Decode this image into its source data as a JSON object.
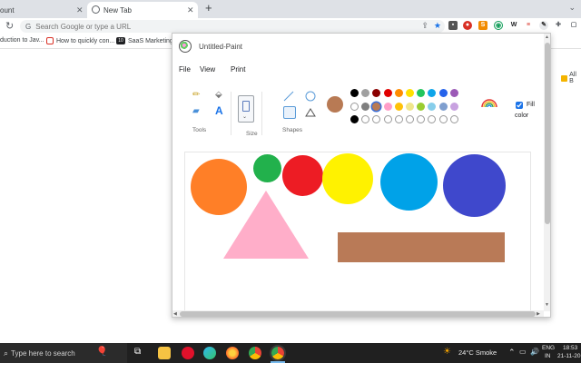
{
  "browser": {
    "tabs": [
      {
        "label": "ount",
        "active": false
      },
      {
        "label": "New Tab",
        "active": true
      }
    ],
    "new_tab_glyph": "+",
    "omnibox": {
      "placeholder": "Search Google or type a URL"
    },
    "bookmarks": [
      {
        "label": "duction to Jav...",
        "icon_color": "#f4b400"
      },
      {
        "label": "How to quickly con...",
        "icon_color": "#d93025"
      },
      {
        "label": "SaaS Marketing P",
        "icon_color": "#202124",
        "icon_text": "10"
      }
    ],
    "bookmarks_right": "All B"
  },
  "paint": {
    "title": "Untitled-Paint",
    "menu": [
      "File",
      "View",
      "Print"
    ],
    "ribbon": {
      "tools_label": "Tools",
      "size_label": "Size",
      "shapes_label": "Shapes",
      "fill_label_1": "Fill",
      "fill_label_2": "color",
      "fill_checked": true,
      "current_color": "#b87a54"
    },
    "palette": {
      "row1": [
        "#000000",
        "#a0a0a0",
        "#8b0000",
        "#e00000",
        "#ff8c00",
        "#ffe000",
        "#22c55e",
        "#0ea5e9",
        "#2563eb",
        "#9b59b6"
      ],
      "row2": [
        "#ffffff",
        "#7f7f7f",
        "#b87a54",
        "#ff9ec8",
        "#ffc107",
        "#f0e68c",
        "#9acd32",
        "#87ceeb",
        "#7f9fcf",
        "#c8a2e0"
      ],
      "row3": [
        "#000000",
        "empty",
        "empty",
        "empty",
        "empty",
        "empty",
        "empty",
        "empty",
        "empty",
        "empty"
      ]
    },
    "shapes": [
      {
        "name": "orange-circle",
        "color": "#ff7f27"
      },
      {
        "name": "green-circle",
        "color": "#22b14c"
      },
      {
        "name": "red-circle",
        "color": "#ed1c24"
      },
      {
        "name": "yellow-circle",
        "color": "#fff200"
      },
      {
        "name": "blue-circle",
        "color": "#00a2e8"
      },
      {
        "name": "indigo-circle",
        "color": "#3f48cc"
      },
      {
        "name": "pink-triangle",
        "color": "#ffaec9"
      },
      {
        "name": "brown-rectangle",
        "color": "#b97a57"
      }
    ]
  },
  "taskbar": {
    "search_placeholder": "Type here to search",
    "weather": "24°C  Smoke",
    "lang_1": "ENG",
    "lang_2": "IN",
    "time": "18:53",
    "date": "21-11-20"
  }
}
